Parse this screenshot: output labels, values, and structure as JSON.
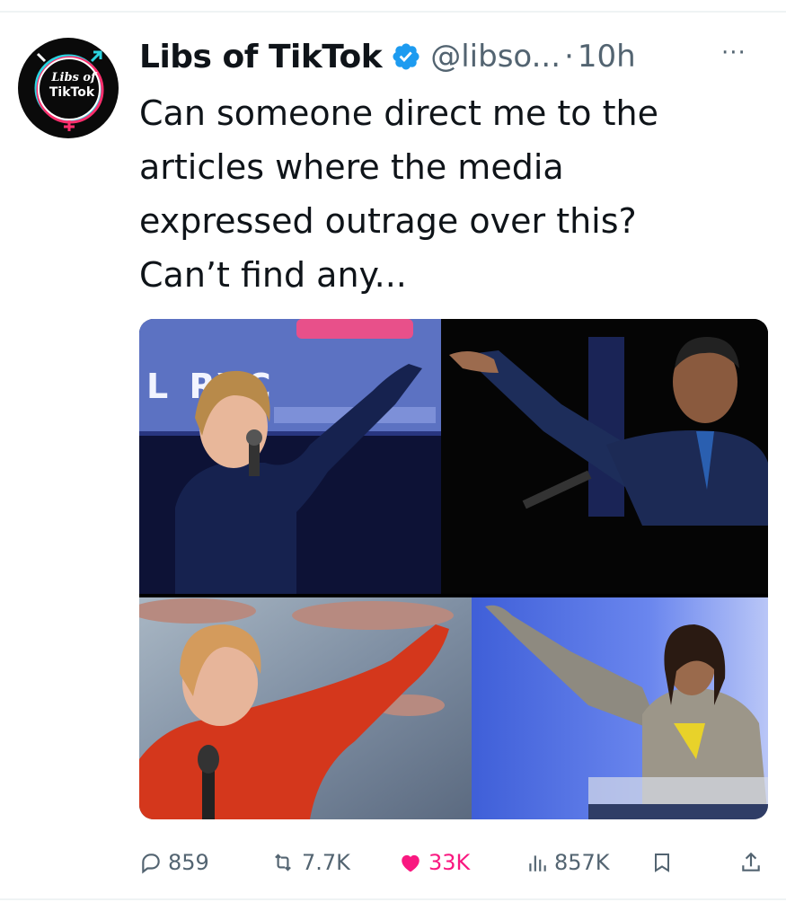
{
  "tweet": {
    "avatar": {
      "line1": "Libs of",
      "line2": "TikTok"
    },
    "display_name": "Libs of TikTok",
    "handle": "@libso...",
    "separator": "·",
    "time": "10h",
    "more": "···",
    "text_lines": [
      "Can someone direct me to the",
      "articles where the media",
      "expressed outrage over this?",
      "Can’t find any..."
    ],
    "media": {
      "banner_text": "L   RYC"
    },
    "actions": {
      "replies": "859",
      "reposts": "7.7K",
      "likes": "33K",
      "views": "857K"
    }
  },
  "colors": {
    "text": "#0f1419",
    "secondary": "#536471",
    "verified": "#1d9bf0",
    "like": "#f91880"
  }
}
